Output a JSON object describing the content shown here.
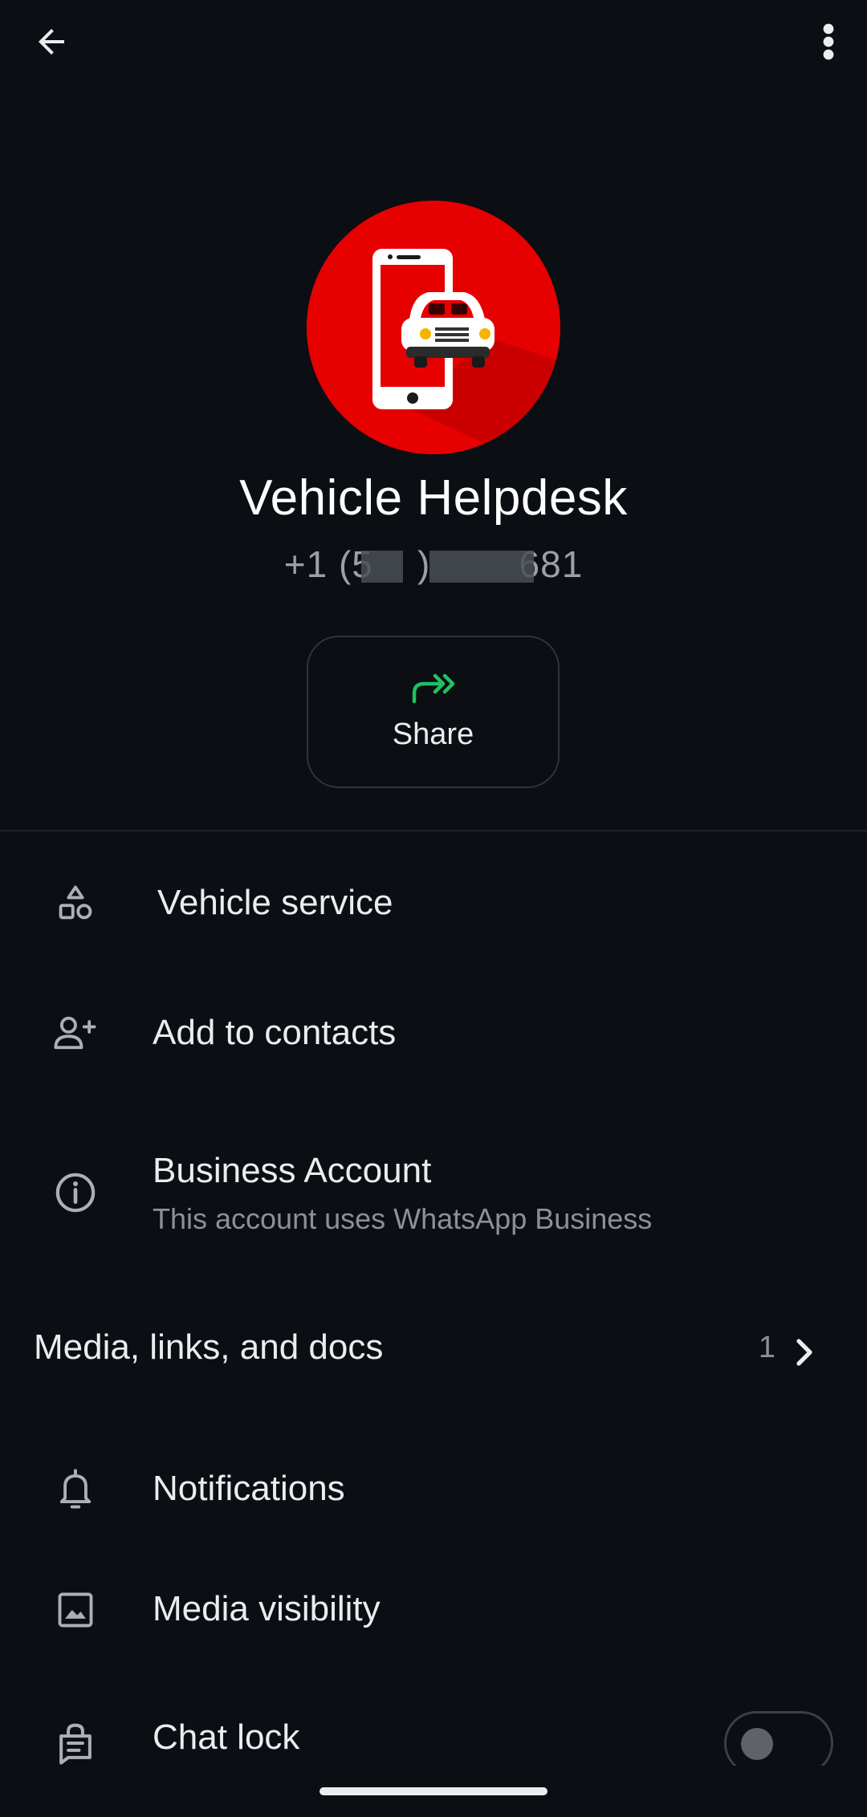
{
  "header": {
    "back_icon": "arrow-left-icon",
    "menu_icon": "more-vert-icon"
  },
  "profile": {
    "name": "Vehicle Helpdesk",
    "phone": "+1 (5    )        681",
    "avatar_icon": "phone-and-car-logo",
    "avatar_color": "#e60000"
  },
  "actions": {
    "share_label": "Share",
    "share_icon": "share-forward-icon",
    "accent_color": "#21c063"
  },
  "rows": {
    "category": {
      "label": "Vehicle service",
      "icon": "category-shapes-icon"
    },
    "add_contact": {
      "label": "Add to contacts",
      "icon": "person-add-icon"
    },
    "business": {
      "label": "Business Account",
      "sublabel": "This account uses WhatsApp Business",
      "icon": "info-icon"
    },
    "media": {
      "label": "Media, links, and docs",
      "count": "1",
      "icon": "chevron-right-icon"
    },
    "notifications": {
      "label": "Notifications",
      "icon": "bell-icon"
    },
    "media_visibility": {
      "label": "Media visibility",
      "icon": "image-icon"
    },
    "chat_lock": {
      "label": "Chat lock",
      "icon": "lock-chat-icon",
      "enabled": false
    }
  }
}
